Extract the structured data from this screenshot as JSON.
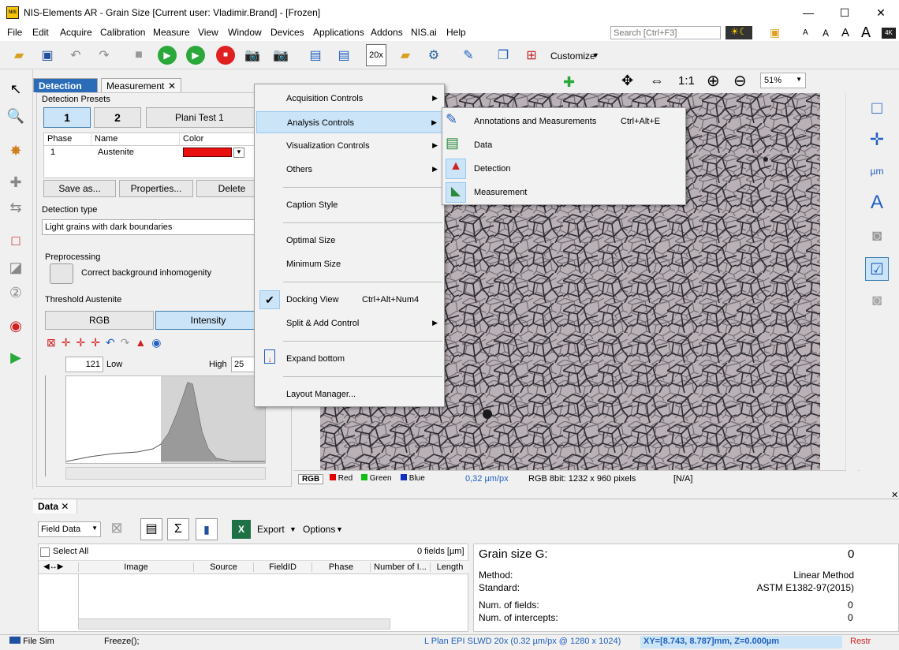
{
  "window": {
    "title": "NIS-Elements AR - Grain Size [Current user: Vladimir.Brand]  - [Frozen]",
    "logo_text": "NIS",
    "minimize": "—",
    "maximize": "☐",
    "close": "✕"
  },
  "menubar": [
    "File",
    "Edit",
    "Acquire",
    "Calibration",
    "Measure",
    "View",
    "Window",
    "Devices",
    "Applications",
    "Addons",
    "NIS.ai",
    "Help"
  ],
  "search": {
    "placeholder": "Search [Ctrl+F3]"
  },
  "font_sizes": [
    "A",
    "A",
    "A",
    "A"
  ],
  "toolbar": {
    "zoom_label": "20x",
    "customize": "Customize"
  },
  "detection_panel": {
    "tabs": [
      "Detection",
      "Measurement"
    ],
    "presets_label": "Detection Presets",
    "preset_buttons": [
      "1",
      "2"
    ],
    "preset_name": "Plani Test 1",
    "grid_headers": [
      "Phase",
      "Name",
      "Color"
    ],
    "grid_row": {
      "phase": "1",
      "name": "Austenite"
    },
    "buttons": [
      "Save as...",
      "Properties...",
      "Delete"
    ],
    "detection_type_label": "Detection type",
    "detection_type_value": "Light grains with dark boundaries",
    "preprocessing_label": "Preprocessing",
    "preprocessing_option": "Correct background inhomogenity",
    "threshold_label": "Threshold Austenite",
    "threshold_tabs": [
      "RGB",
      "Intensity"
    ],
    "low_value": "121",
    "low_label": "Low",
    "high_label": "High",
    "high_value": "25"
  },
  "image_toolbar": {
    "zoom": "51%",
    "ratio": "1:1"
  },
  "image_channels": [
    "RGB",
    "Red",
    "Green",
    "Blue"
  ],
  "image_status": {
    "pixel_size": "0,32 µm/px",
    "format": "RGB 8bit: 1232 x 960 pixels",
    "na": "[N/A]"
  },
  "context_menu": [
    {
      "label": "Acquisition Controls",
      "submenu": true
    },
    {
      "label": "Analysis Controls",
      "submenu": true,
      "highlighted": true
    },
    {
      "label": "Visualization Controls",
      "submenu": true
    },
    {
      "label": "Others",
      "submenu": true
    },
    {
      "label": "Caption Style"
    },
    {
      "label": "Optimal Size"
    },
    {
      "label": "Minimum Size"
    },
    {
      "label": "Docking View",
      "shortcut": "Ctrl+Alt+Num4",
      "checked": true
    },
    {
      "label": "Split & Add Control",
      "submenu": true
    },
    {
      "label": "Expand bottom"
    },
    {
      "label": "Layout Manager..."
    }
  ],
  "submenu": [
    {
      "label": "Annotations and Measurements",
      "shortcut": "Ctrl+Alt+E"
    },
    {
      "label": "Data"
    },
    {
      "label": "Detection"
    },
    {
      "label": "Measurement"
    }
  ],
  "data_panel": {
    "title": "Data",
    "selector": "Field Data",
    "export": "Export",
    "options": "Options",
    "select_all": "Select All",
    "fields_count": "0 fields [µm]",
    "columns": [
      "Image",
      "Source",
      "FieldID",
      "Phase",
      "Number of I...",
      "Length"
    ],
    "grain_size_label": "Grain size G:",
    "grain_size_value": "0",
    "method_label": "Method:",
    "method_value": "Linear Method",
    "standard_label": "Standard:",
    "standard_value": "ASTM E1382-97(2015)",
    "num_fields_label": "Num. of fields:",
    "num_fields_value": "0",
    "num_intercepts_label": "Num. of intercepts:",
    "num_intercepts_value": "0"
  },
  "statusbar": {
    "file": "File Sim",
    "command": "Freeze();",
    "objective": "L Plan EPI SLWD 20x (0.32 µm/px @ 1280 x 1024)",
    "position": "XY=[8.743, 8.787]mm, Z=0.000µm",
    "restr": "Restr"
  },
  "colors": {
    "accent": "#cce4f7",
    "title_tab": "#2b6cb8",
    "phase_color": "#e81010"
  }
}
